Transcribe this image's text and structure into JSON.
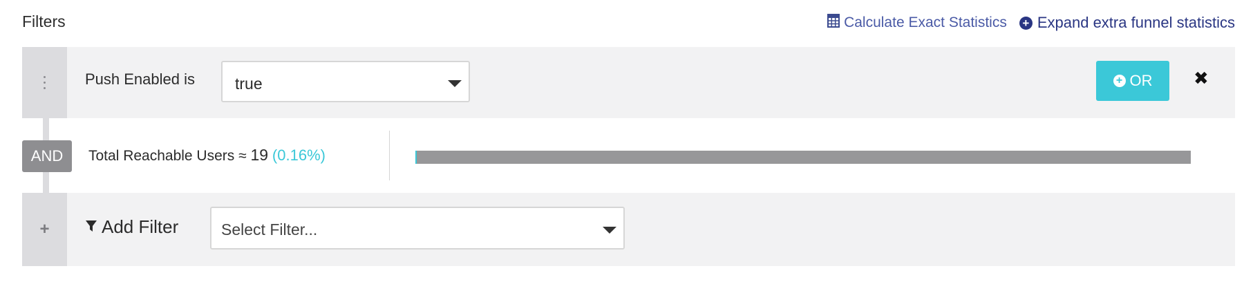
{
  "header": {
    "title": "Filters",
    "calc_label": "Calculate Exact Statistics",
    "expand_label": "Expand extra funnel statistics"
  },
  "filter_row": {
    "label": "Push Enabled is",
    "select_value": "true",
    "or_label": "OR",
    "close_glyph": "✖"
  },
  "and_badge": "AND",
  "reach": {
    "label": "Total Reachable Users ≈",
    "count": "19",
    "percent": "(0.16%)",
    "progress_fraction": 0.0016
  },
  "add_filter": {
    "label": "Add Filter",
    "placeholder": "Select Filter..."
  },
  "icons": {
    "calc": "calculator-icon",
    "expand": "plus-circle-icon",
    "or": "plus-circle-icon",
    "close": "close-icon",
    "drag": "drag-handle-icon",
    "add": "plus-icon",
    "filter": "funnel-icon"
  },
  "colors": {
    "accent": "#3bc8d8",
    "link": "#2a3683",
    "badge": "#8e8e91",
    "progress_track": "#979799"
  }
}
